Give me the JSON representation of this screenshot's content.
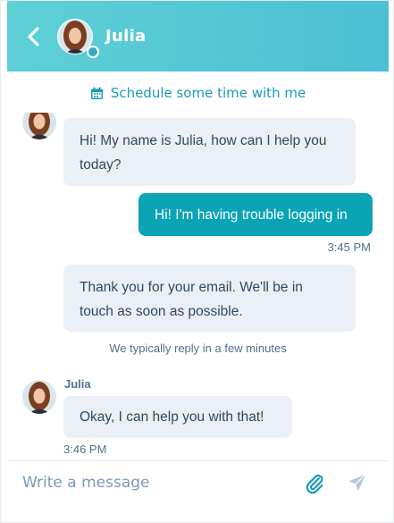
{
  "header": {
    "agent_name": "Julia"
  },
  "schedule": {
    "label": "Schedule some time with me"
  },
  "messages": [
    {
      "from": "agent",
      "text": "Hi! My name is Julia, how can I help you today?"
    },
    {
      "from": "user",
      "text": "Hi! I'm having trouble logging in",
      "time": "3:45 PM"
    },
    {
      "from": "agent",
      "text": "Thank you for your email. We'll be in touch as soon as possible."
    },
    {
      "from": "agent",
      "sender": "Julia",
      "text": "Okay, I can help you with that!",
      "time": "3:46 PM"
    }
  ],
  "reply_note": "We typically reply in a few minutes",
  "composer": {
    "placeholder": "Write a message"
  },
  "colors": {
    "header_gradient_start": "#5ed0d6",
    "header_gradient_end": "#4bbfd4",
    "accent": "#1a9bb3",
    "user_bubble": "#0aa4b5",
    "agent_bubble": "#eaf0f6",
    "status_dot": "#3aa7c7"
  },
  "icons": {
    "back": "chevron-left-icon",
    "schedule": "calendar-icon",
    "attach": "paperclip-icon",
    "send": "paper-plane-icon"
  }
}
